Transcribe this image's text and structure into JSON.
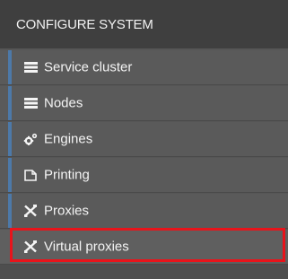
{
  "header": {
    "title": "CONFIGURE SYSTEM"
  },
  "menu": {
    "items": [
      {
        "label": "Service cluster",
        "icon": "list-icon"
      },
      {
        "label": "Nodes",
        "icon": "list-icon"
      },
      {
        "label": "Engines",
        "icon": "gears-icon"
      },
      {
        "label": "Printing",
        "icon": "document-icon"
      },
      {
        "label": "Proxies",
        "icon": "tools-icon"
      },
      {
        "label": "Virtual proxies",
        "icon": "tools-icon",
        "highlighted": true
      }
    ]
  },
  "colors": {
    "header_bg": "#3f3f3f",
    "item_bg": "#5a5a5a",
    "accent": "#4d79a8",
    "highlight": "#e8141b",
    "text": "#f4f4f4"
  }
}
